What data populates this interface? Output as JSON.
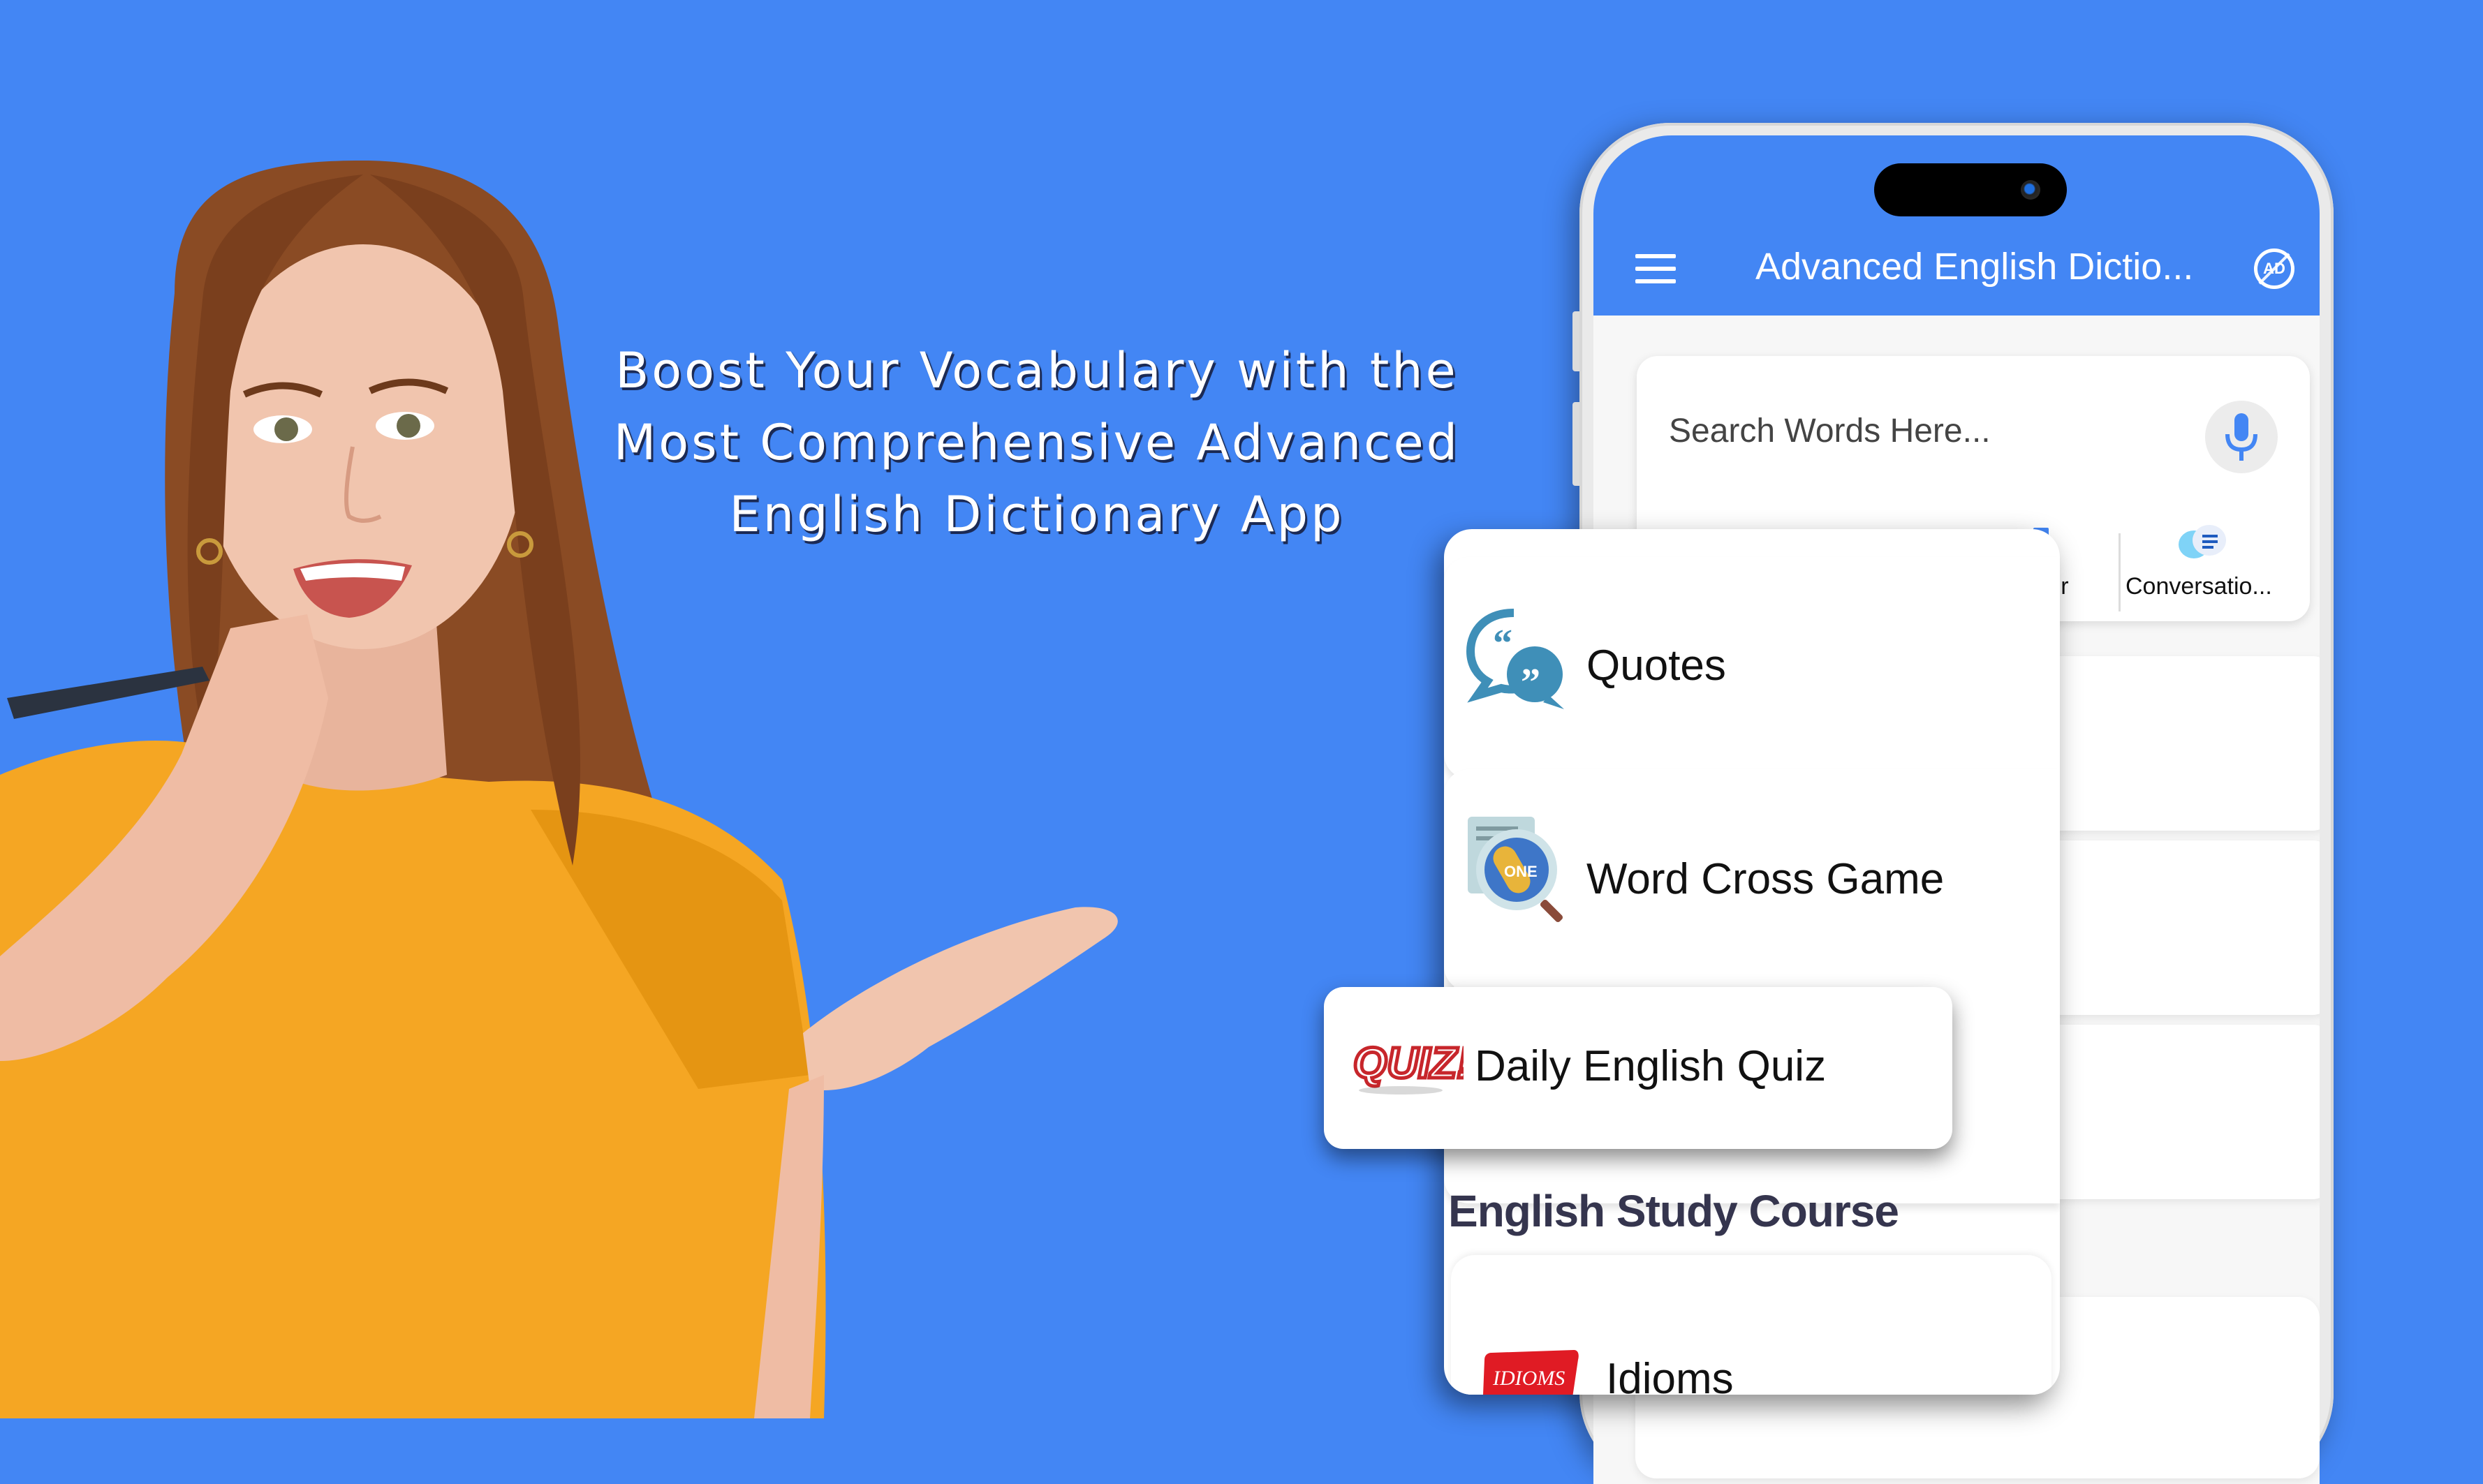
{
  "colors": {
    "background": "#4386f4",
    "app_bar": "#4386f4",
    "shirt": "#f5a623",
    "hair": "#8a4b24",
    "section_title": "#35354e"
  },
  "promo": {
    "headline_lines": [
      "Boost Your Vocabulary with the",
      "Most Comprehensive Advanced",
      "English Dictionary App"
    ]
  },
  "app": {
    "title": "Advanced English Dictio...",
    "menu_icon": "hamburger-menu-icon",
    "ad_icon": "remove-ads-icon",
    "ad_label": "AD",
    "search": {
      "placeholder": "Search Words Here...",
      "value": "",
      "mic_icon": "microphone-icon"
    },
    "features": [
      {
        "label": "ator",
        "icon": "translator-icon"
      },
      {
        "label": "Conversatio...",
        "icon": "conversation-icon"
      }
    ],
    "menu_panel": {
      "items": [
        {
          "label": "Quotes",
          "icon": "quotes-icon"
        },
        {
          "label": "Word Cross Game",
          "icon": "word-cross-game-icon"
        }
      ],
      "floating_item": {
        "label": "Daily English Quiz",
        "icon": "quiz-icon"
      },
      "section_title": "English Study Course",
      "section_items": [
        {
          "label": "Idioms",
          "icon": "idioms-icon",
          "icon_text": "IDIOMS"
        }
      ]
    }
  }
}
